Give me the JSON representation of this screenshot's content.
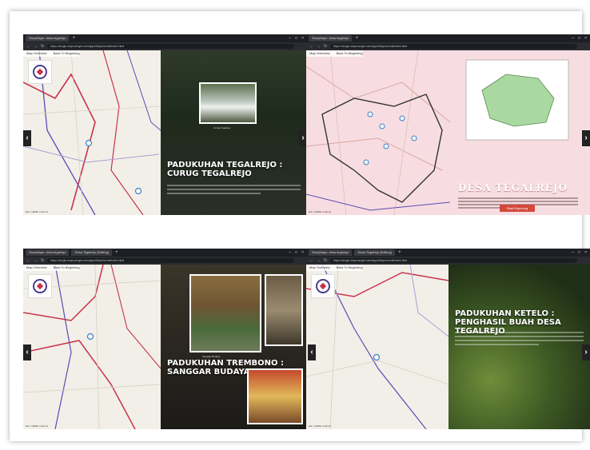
{
  "screenshots": [
    {
      "tabs": [
        "StoryMaps: desa tegalrejo"
      ],
      "url": "https://arcgis.maps.arcgis.com/apps/MapJournal/index.html",
      "nav": [
        "Map Overview",
        "Back To Beginning"
      ],
      "title": "PADUKUHAN TEGALREJO : CURUG TEGALREJO",
      "photo_caption": "Curug Tegalrejo",
      "attribution": "Esri | HERE | Garmin"
    },
    {
      "tabs": [
        "StoryMaps: desa tegalrejo"
      ],
      "url": "https://arcgis.maps.arcgis.com/apps/MapJournal/index.html",
      "nav": [
        "Map Overview",
        "Back To Beginning"
      ],
      "title": "DESA TEGALREJO",
      "button": "Start Exploring",
      "attribution": "Esri | HERE | Garmin"
    },
    {
      "tabs": [
        "StoryMaps: desa tegalrejo",
        "Desa Tegalrejo (Editing)"
      ],
      "url": "https://arcgis.maps.arcgis.com/apps/MapJournal/index.html",
      "nav": [
        "Map Overview",
        "Back To Beginning"
      ],
      "title": "PADUKUHAN TREMBONO : SANGGAR BUDAYA",
      "photo_caption": "Sanggar Budaya",
      "attribution": "Esri | HERE | Garmin"
    },
    {
      "tabs": [
        "StoryMaps: desa tegalrejo",
        "Desa Tegalrejo (Editing)"
      ],
      "url": "https://arcgis.maps.arcgis.com/apps/MapJournal/index.html",
      "nav": [
        "Map Overview",
        "Back To Beginning"
      ],
      "title": "PADUKUHAN KETELO : PENGHASIL BUAH DESA TEGALREJO",
      "attribution": "Esri | HERE | Garmin"
    }
  ],
  "icons": {
    "prev": "chevron-left-icon",
    "next": "chevron-right-icon",
    "pin": "map-pin-icon",
    "logo": "storymap-logo-icon"
  },
  "colors": {
    "accent_button": "#d4493a",
    "road_red": "#c8334a",
    "road_purple": "#5b4bb7",
    "pin_blue": "#3a7dc8",
    "browser_dark": "#1e1f24"
  }
}
